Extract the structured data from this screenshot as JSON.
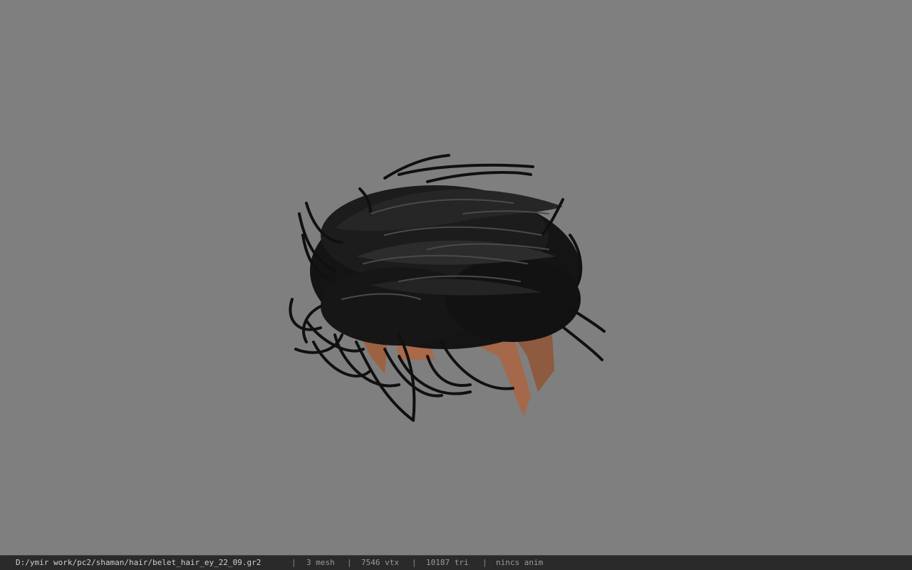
{
  "viewer": {
    "background_color": "#7f7f7f",
    "model_name": "hair mesh",
    "hair_color": "#141414",
    "skin_color": "#a86a48"
  },
  "status": {
    "file_path": "D:/ymir work/pc2/shaman/hair/belet_hair_ey_22_09.gr2",
    "separator": "|",
    "mesh_count": "3 mesh",
    "vertex_count": "7546 vtx",
    "triangle_count": "10187 tri",
    "animation": "nincs anim"
  }
}
